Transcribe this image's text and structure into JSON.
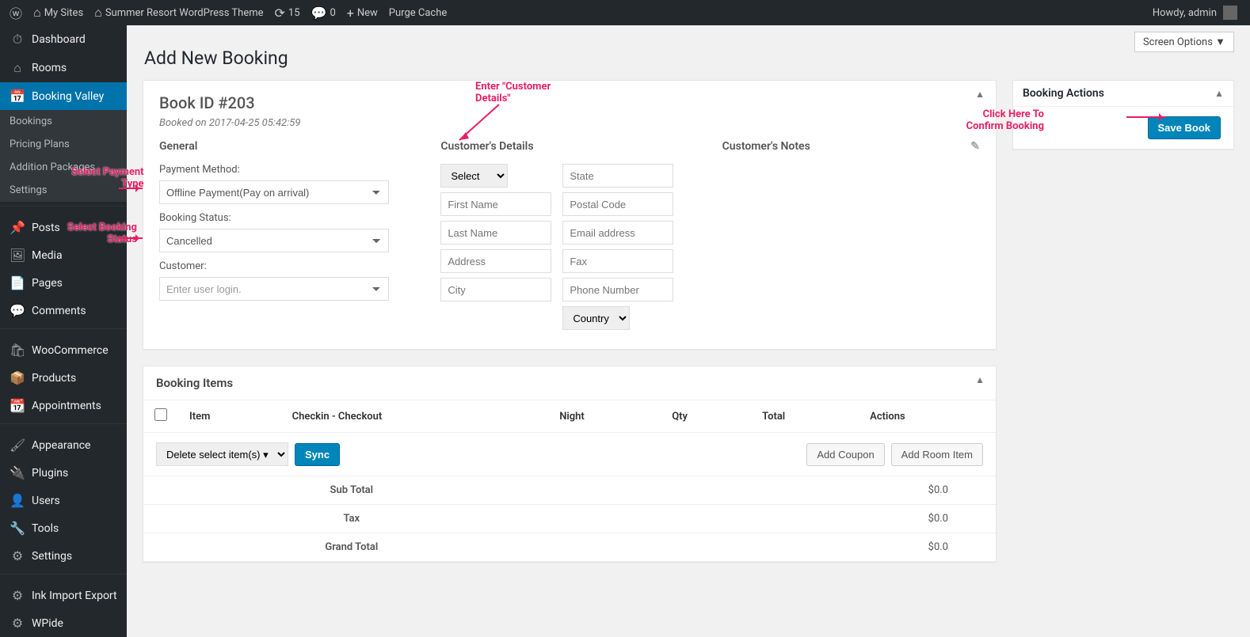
{
  "adminbar": {
    "mysites": "My Sites",
    "sitename": "Summer Resort WordPress Theme",
    "updates": "15",
    "comments": "0",
    "new": "New",
    "purge": "Purge Cache",
    "howdy": "Howdy, admin"
  },
  "sidebar": {
    "dashboard": "Dashboard",
    "rooms": "Rooms",
    "booking_valley": "Booking Valley",
    "sub": {
      "bookings": "Bookings",
      "pricing": "Pricing Plans",
      "addition": "Addition Packages",
      "settings": "Settings"
    },
    "posts": "Posts",
    "media": "Media",
    "pages": "Pages",
    "comments": "Comments",
    "woo": "WooCommerce",
    "products": "Products",
    "appointments": "Appointments",
    "appearance": "Appearance",
    "plugins": "Plugins",
    "users": "Users",
    "tools": "Tools",
    "settings2": "Settings",
    "ink": "Ink Import Export",
    "wpide": "WPide"
  },
  "screen_options": "Screen Options ▼",
  "page_title": "Add New Booking",
  "book": {
    "title": "Book ID #203",
    "booked_on": "Booked on 2017-04-25 05:42:59",
    "general": "General",
    "payment_label": "Payment Method:",
    "payment_value": "Offline Payment(Pay on arrival)",
    "status_label": "Booking Status:",
    "status_value": "Cancelled",
    "customer_label": "Customer:",
    "customer_placeholder": "Enter user login.",
    "cust_header": "Customer's Details",
    "cust_select": "Select",
    "first_name": "First Name",
    "last_name": "Last Name",
    "address": "Address",
    "city": "City",
    "state": "State",
    "postal": "Postal Code",
    "email": "Email address",
    "fax": "Fax",
    "phone": "Phone Number",
    "country": "Country",
    "notes_header": "Customer's Notes"
  },
  "items": {
    "title": "Booking Items",
    "col_item": "Item",
    "col_checkin": "Checkin - Checkout",
    "col_night": "Night",
    "col_qty": "Qty",
    "col_total": "Total",
    "col_actions": "Actions",
    "bulk": "Delete select item(s) ▾",
    "sync": "Sync",
    "add_coupon": "Add Coupon",
    "add_room": "Add Room Item",
    "subtotal": "Sub Total",
    "subtotal_v": "$0.0",
    "tax": "Tax",
    "tax_v": "$0.0",
    "grand": "Grand Total",
    "grand_v": "$0.0"
  },
  "sidebox": {
    "title": "Booking Actions",
    "save": "Save Book"
  },
  "anno": {
    "payment": "Select Payment\nType",
    "status": "Select Booking\nStatus",
    "cust": "Enter \"Customer\nDetails\"",
    "confirm": "Click Here To\nConfirm Booking"
  }
}
